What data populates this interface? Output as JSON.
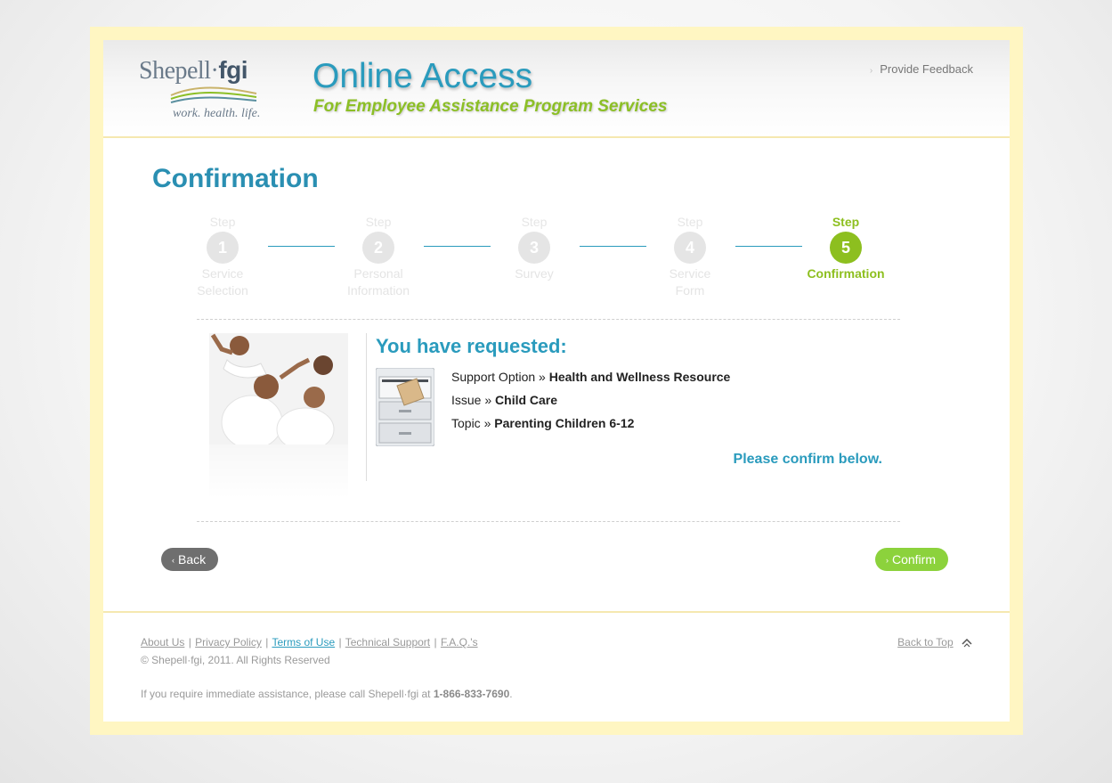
{
  "header": {
    "logo": {
      "name": "Shepell",
      "name_bold": "fgi",
      "tagline": "work. health. life."
    },
    "title": "Online Access",
    "subtitle": "For Employee Assistance Program Services",
    "feedback_link": "Provide Feedback"
  },
  "page_title": "Confirmation",
  "steps": [
    {
      "label": "Step",
      "number": "1",
      "name_line1": "Service",
      "name_line2": "Selection",
      "active": false
    },
    {
      "label": "Step",
      "number": "2",
      "name_line1": "Personal",
      "name_line2": "Information",
      "active": false
    },
    {
      "label": "Step",
      "number": "3",
      "name_line1": "Survey",
      "name_line2": "",
      "active": false
    },
    {
      "label": "Step",
      "number": "4",
      "name_line1": "Service",
      "name_line2": "Form",
      "active": false
    },
    {
      "label": "Step",
      "number": "5",
      "name_line1": "Confirmation",
      "name_line2": "",
      "active": true
    }
  ],
  "request": {
    "heading": "You have requested:",
    "lines": [
      {
        "label": "Support Option »",
        "value": "Health and Wellness Resource"
      },
      {
        "label": "Issue »",
        "value": "Child Care"
      },
      {
        "label": "Topic »",
        "value": "Parenting Children 6-12"
      }
    ],
    "confirm_note": "Please confirm below."
  },
  "buttons": {
    "back": "Back",
    "confirm": "Confirm"
  },
  "footer": {
    "links": [
      {
        "label": "About Us",
        "active": false
      },
      {
        "label": "Privacy Policy",
        "active": false
      },
      {
        "label": "Terms of Use",
        "active": true
      },
      {
        "label": "Technical Support",
        "active": false
      },
      {
        "label": "F.A.Q.'s",
        "active": false
      }
    ],
    "copyright": "© Shepell·fgi, 2011. All Rights Reserved",
    "assist_text": "If you require immediate assistance, please call Shepell·fgi at ",
    "assist_phone": "1-866-833-7690",
    "assist_end": ".",
    "back_to_top": "Back to Top"
  },
  "colors": {
    "accent_blue": "#2a9bbd",
    "accent_green": "#8dbf1f",
    "button_green": "#8cd23c",
    "button_gray": "#6f6f6f",
    "frame_yellow": "#fff6c2"
  },
  "icons": [
    "chevron-right-icon",
    "chevron-left-icon",
    "filing-cabinet-icon",
    "up-arrow-icon"
  ]
}
